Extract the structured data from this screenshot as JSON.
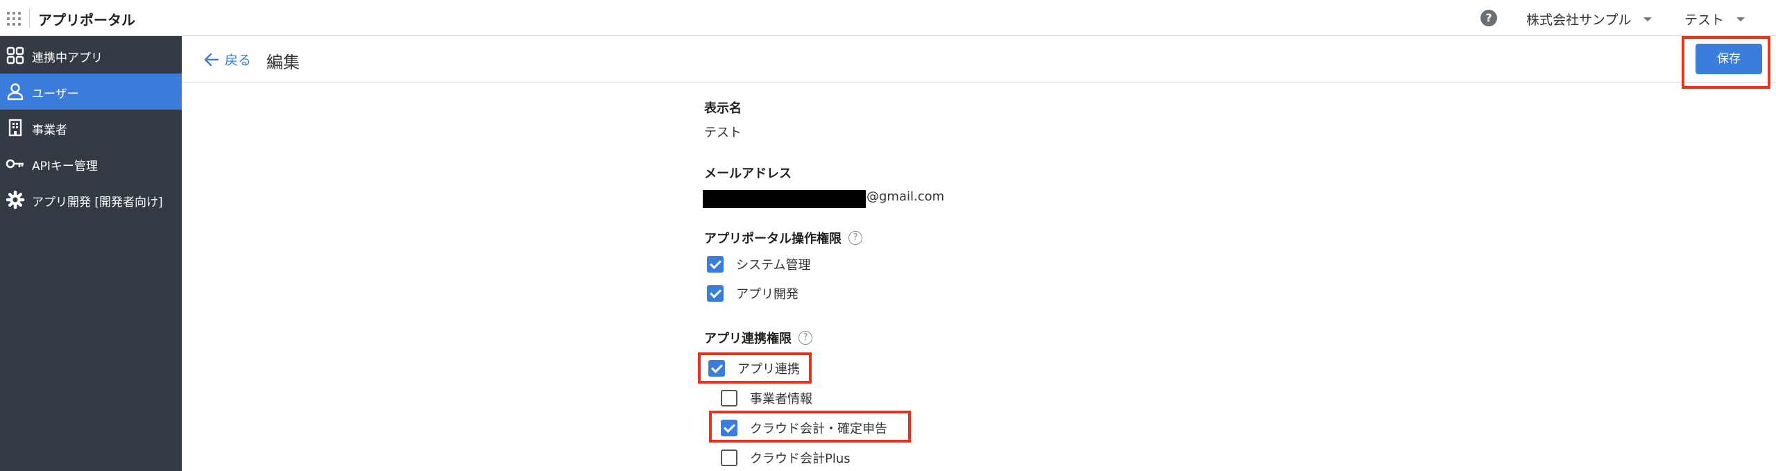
{
  "header": {
    "app_title": "アプリポータル",
    "company": "株式会社サンプル",
    "user": "テスト",
    "help_icon_glyph": "?"
  },
  "sidebar": {
    "items": [
      {
        "label": "連携中アプリ",
        "icon": "grid-apps-icon",
        "active": false
      },
      {
        "label": "ユーザー",
        "icon": "user-icon",
        "active": true
      },
      {
        "label": "事業者",
        "icon": "building-icon",
        "active": false
      },
      {
        "label": "APIキー管理",
        "icon": "key-icon",
        "active": false
      },
      {
        "label": "アプリ開発 [開発者向け]",
        "icon": "gear-icon",
        "active": false
      }
    ]
  },
  "subheader": {
    "back_label": "戻る",
    "title": "編集",
    "save_label": "保存"
  },
  "form": {
    "display_name": {
      "label": "表示名",
      "value": "テスト"
    },
    "email": {
      "label": "メールアドレス",
      "value_suffix": "@gmail.com",
      "redacted": true
    },
    "portal_permissions": {
      "label": "アプリポータル操作権限",
      "help_glyph": "?",
      "options": [
        {
          "label": "システム管理",
          "checked": true
        },
        {
          "label": "アプリ開発",
          "checked": true
        }
      ]
    },
    "app_permissions": {
      "label": "アプリ連携権限",
      "help_glyph": "?",
      "parent": {
        "label": "アプリ連携",
        "checked": true
      },
      "children": [
        {
          "label": "事業者情報",
          "checked": false
        },
        {
          "label": "クラウド会計・確定申告",
          "checked": true
        },
        {
          "label": "クラウド会計Plus",
          "checked": false
        }
      ]
    }
  },
  "colors": {
    "accent": "#3b7ddd",
    "sidebar_bg": "#343a44",
    "highlight": "#e8321e"
  }
}
